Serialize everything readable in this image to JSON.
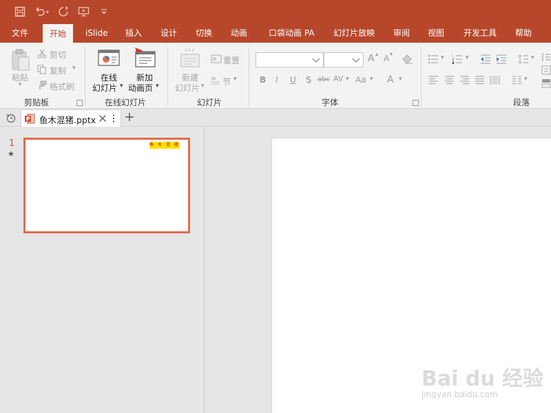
{
  "tabs": [
    {
      "label": "文件"
    },
    {
      "label": "开始"
    },
    {
      "label": "iSlide"
    },
    {
      "label": "插入"
    },
    {
      "label": "设计"
    },
    {
      "label": "切换"
    },
    {
      "label": "动画"
    },
    {
      "label": "口袋动画 PA"
    },
    {
      "label": "幻灯片放映"
    },
    {
      "label": "审阅"
    },
    {
      "label": "视图"
    },
    {
      "label": "开发工具"
    },
    {
      "label": "帮助"
    }
  ],
  "clipboard": {
    "paste": "粘贴",
    "cut": "剪切",
    "copy": "复制",
    "format_painter": "格式刷",
    "label": "剪贴板"
  },
  "online": {
    "online_slides_line1": "在线",
    "online_slides_line2": "幻灯片",
    "new_anim_line1": "新加",
    "new_anim_line2": "动画页",
    "label": "在线幻灯片"
  },
  "slides": {
    "new_slide_line1": "新建",
    "new_slide_line2": "幻灯片",
    "reset": "重置",
    "section": "节",
    "label": "幻灯片"
  },
  "font": {
    "label": "字体",
    "bold": "B",
    "italic": "I",
    "underline": "U",
    "shadow": "S",
    "strike": "abc",
    "spacing": "AV",
    "case": "Aa",
    "color": "A",
    "grow": "A",
    "shrink": "A"
  },
  "paragraph": {
    "label": "段落"
  },
  "document": {
    "filename": "鱼木混猪.pptx"
  },
  "thumbnail": {
    "number": "1",
    "star": "★",
    "title_text": "鱼 木 混 猪"
  },
  "watermark": {
    "brand": "Bai du 经验",
    "url": "jingyan.baidu.com"
  },
  "colors": {
    "accent": "#b7472a",
    "thumb_border": "#e46c4f"
  }
}
